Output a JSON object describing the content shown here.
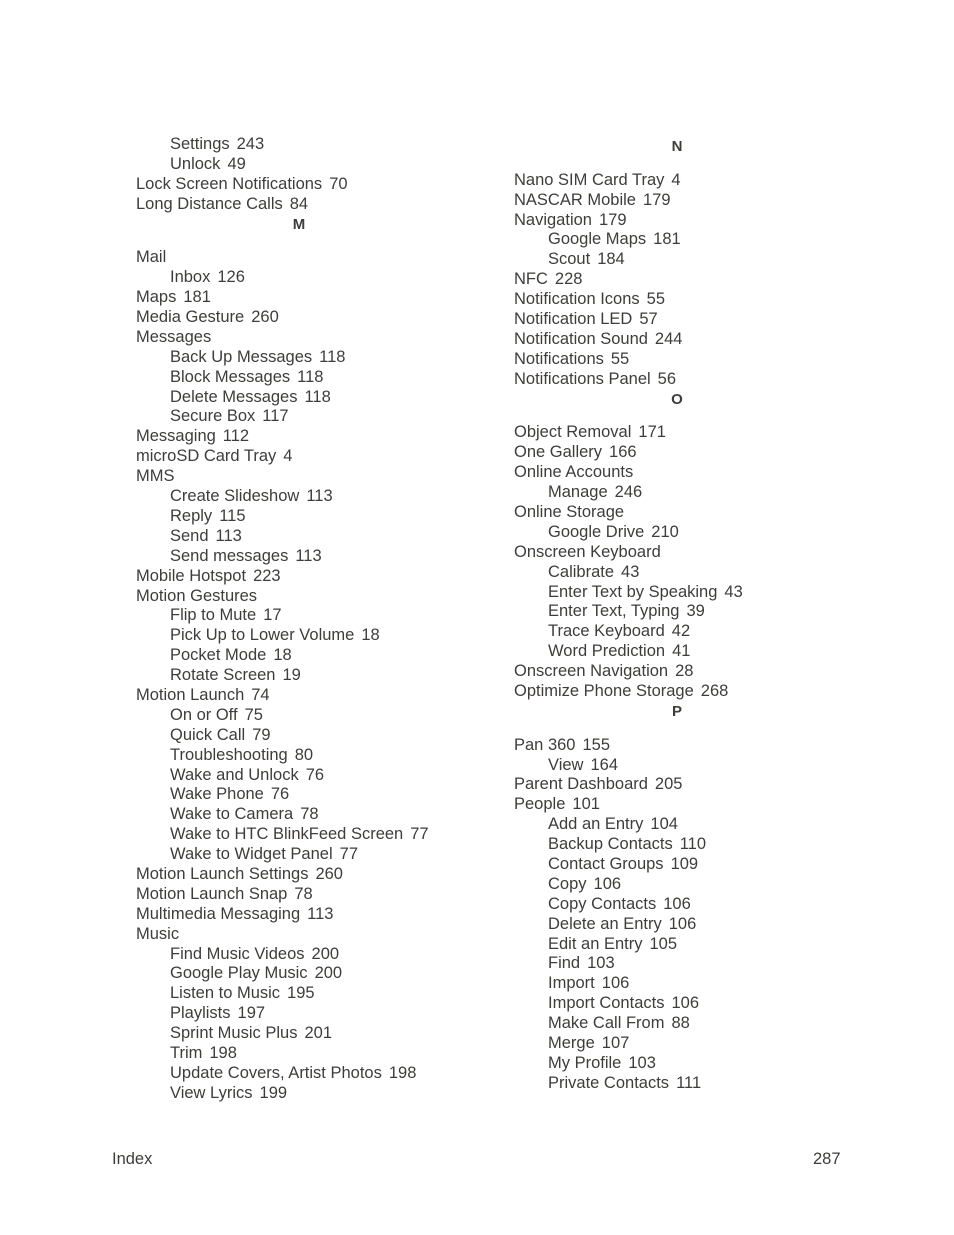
{
  "left_column": [
    {
      "type": "sub",
      "term": "Settings",
      "page": "243"
    },
    {
      "type": "sub",
      "term": "Unlock",
      "page": "49"
    },
    {
      "type": "main",
      "term": "Lock Screen Notifications",
      "page": "70"
    },
    {
      "type": "main",
      "term": "Long Distance Calls",
      "page": "84"
    },
    {
      "type": "heading",
      "term": "M"
    },
    {
      "type": "main",
      "term": "Mail",
      "page": ""
    },
    {
      "type": "sub",
      "term": "Inbox",
      "page": "126"
    },
    {
      "type": "main",
      "term": "Maps",
      "page": "181"
    },
    {
      "type": "main",
      "term": "Media Gesture",
      "page": "260"
    },
    {
      "type": "main",
      "term": "Messages",
      "page": ""
    },
    {
      "type": "sub",
      "term": "Back Up Messages",
      "page": "118"
    },
    {
      "type": "sub",
      "term": "Block Messages",
      "page": "118"
    },
    {
      "type": "sub",
      "term": "Delete Messages",
      "page": "118"
    },
    {
      "type": "sub",
      "term": "Secure Box",
      "page": "117"
    },
    {
      "type": "main",
      "term": "Messaging",
      "page": "112"
    },
    {
      "type": "main",
      "term": "microSD Card Tray",
      "page": "4"
    },
    {
      "type": "main",
      "term": "MMS",
      "page": ""
    },
    {
      "type": "sub",
      "term": "Create Slideshow",
      "page": "113"
    },
    {
      "type": "sub",
      "term": "Reply",
      "page": "115"
    },
    {
      "type": "sub",
      "term": "Send",
      "page": "113"
    },
    {
      "type": "sub",
      "term": "Send messages",
      "page": "113"
    },
    {
      "type": "main",
      "term": "Mobile Hotspot",
      "page": "223"
    },
    {
      "type": "main",
      "term": "Motion Gestures",
      "page": ""
    },
    {
      "type": "sub",
      "term": "Flip to Mute",
      "page": "17"
    },
    {
      "type": "sub",
      "term": "Pick Up to Lower Volume",
      "page": "18"
    },
    {
      "type": "sub",
      "term": "Pocket Mode",
      "page": "18"
    },
    {
      "type": "sub",
      "term": "Rotate Screen",
      "page": "19"
    },
    {
      "type": "main",
      "term": "Motion Launch",
      "page": "74"
    },
    {
      "type": "sub",
      "term": "On or Off",
      "page": "75"
    },
    {
      "type": "sub",
      "term": "Quick Call",
      "page": "79"
    },
    {
      "type": "sub",
      "term": "Troubleshooting",
      "page": "80"
    },
    {
      "type": "sub",
      "term": "Wake and Unlock",
      "page": "76"
    },
    {
      "type": "sub",
      "term": "Wake Phone",
      "page": "76"
    },
    {
      "type": "sub",
      "term": "Wake to Camera",
      "page": "78"
    },
    {
      "type": "sub",
      "term": "Wake to HTC BlinkFeed Screen",
      "page": "77"
    },
    {
      "type": "sub",
      "term": "Wake to Widget Panel",
      "page": "77"
    },
    {
      "type": "main",
      "term": "Motion Launch Settings",
      "page": "260"
    },
    {
      "type": "main",
      "term": "Motion Launch Snap",
      "page": "78"
    },
    {
      "type": "main",
      "term": "Multimedia Messaging",
      "page": "113"
    },
    {
      "type": "main",
      "term": "Music",
      "page": ""
    },
    {
      "type": "sub",
      "term": "Find Music Videos",
      "page": "200"
    },
    {
      "type": "sub",
      "term": "Google Play Music",
      "page": "200"
    },
    {
      "type": "sub",
      "term": "Listen to Music",
      "page": "195"
    },
    {
      "type": "sub",
      "term": "Playlists",
      "page": "197"
    },
    {
      "type": "sub",
      "term": "Sprint Music Plus",
      "page": "201"
    },
    {
      "type": "sub",
      "term": "Trim",
      "page": "198"
    },
    {
      "type": "sub",
      "term": "Update Covers, Artist Photos",
      "page": "198"
    },
    {
      "type": "sub",
      "term": "View Lyrics",
      "page": "199"
    }
  ],
  "right_column": [
    {
      "type": "heading",
      "term": "N"
    },
    {
      "type": "main",
      "term": "Nano SIM Card Tray",
      "page": "4"
    },
    {
      "type": "main",
      "term": "NASCAR Mobile",
      "page": "179"
    },
    {
      "type": "main",
      "term": "Navigation",
      "page": "179"
    },
    {
      "type": "sub",
      "term": "Google Maps",
      "page": "181"
    },
    {
      "type": "sub",
      "term": "Scout",
      "page": "184"
    },
    {
      "type": "main",
      "term": "NFC",
      "page": "228"
    },
    {
      "type": "main",
      "term": "Notification Icons",
      "page": "55"
    },
    {
      "type": "main",
      "term": "Notification LED",
      "page": "57"
    },
    {
      "type": "main",
      "term": "Notification Sound",
      "page": "244"
    },
    {
      "type": "main",
      "term": "Notifications",
      "page": "55"
    },
    {
      "type": "main",
      "term": "Notifications Panel",
      "page": "56"
    },
    {
      "type": "heading",
      "term": "O"
    },
    {
      "type": "main",
      "term": "Object Removal",
      "page": "171"
    },
    {
      "type": "main",
      "term": "One Gallery",
      "page": "166"
    },
    {
      "type": "main",
      "term": "Online Accounts",
      "page": ""
    },
    {
      "type": "sub",
      "term": "Manage",
      "page": "246"
    },
    {
      "type": "main",
      "term": "Online Storage",
      "page": ""
    },
    {
      "type": "sub",
      "term": "Google Drive",
      "page": "210"
    },
    {
      "type": "main",
      "term": "Onscreen Keyboard",
      "page": ""
    },
    {
      "type": "sub",
      "term": "Calibrate",
      "page": "43"
    },
    {
      "type": "sub",
      "term": "Enter Text by Speaking",
      "page": "43"
    },
    {
      "type": "sub",
      "term": "Enter Text, Typing",
      "page": "39"
    },
    {
      "type": "sub",
      "term": "Trace Keyboard",
      "page": "42"
    },
    {
      "type": "sub",
      "term": "Word Prediction",
      "page": "41"
    },
    {
      "type": "main",
      "term": "Onscreen Navigation",
      "page": "28"
    },
    {
      "type": "main",
      "term": "Optimize Phone Storage",
      "page": "268"
    },
    {
      "type": "heading",
      "term": "P"
    },
    {
      "type": "main",
      "term": "Pan 360",
      "page": "155"
    },
    {
      "type": "sub",
      "term": "View",
      "page": "164"
    },
    {
      "type": "main",
      "term": "Parent Dashboard",
      "page": "205"
    },
    {
      "type": "main",
      "term": "People",
      "page": "101"
    },
    {
      "type": "sub",
      "term": "Add an Entry",
      "page": "104"
    },
    {
      "type": "sub",
      "term": "Backup Contacts",
      "page": "110"
    },
    {
      "type": "sub",
      "term": "Contact Groups",
      "page": "109"
    },
    {
      "type": "sub",
      "term": "Copy",
      "page": "106"
    },
    {
      "type": "sub",
      "term": "Copy Contacts",
      "page": "106"
    },
    {
      "type": "sub",
      "term": "Delete an Entry",
      "page": "106"
    },
    {
      "type": "sub",
      "term": "Edit an Entry",
      "page": "105"
    },
    {
      "type": "sub",
      "term": "Find",
      "page": "103"
    },
    {
      "type": "sub",
      "term": "Import",
      "page": "106"
    },
    {
      "type": "sub",
      "term": "Import Contacts",
      "page": "106"
    },
    {
      "type": "sub",
      "term": "Make Call From",
      "page": "88"
    },
    {
      "type": "sub",
      "term": "Merge",
      "page": "107"
    },
    {
      "type": "sub",
      "term": "My Profile",
      "page": "103"
    },
    {
      "type": "sub",
      "term": "Private Contacts",
      "page": "111"
    }
  ],
  "footer": {
    "section": "Index",
    "page_number": "287"
  }
}
